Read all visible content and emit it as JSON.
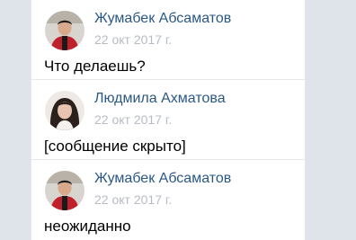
{
  "messages": [
    {
      "author": "Жумабек Абсаматов",
      "date": "22 окт 2017 г.",
      "text": "Что делаешь?",
      "avatar": "male-avatar"
    },
    {
      "author": "Людмила Ахматова",
      "date": "22 окт 2017 г.",
      "text": "[сообщение скрыто]",
      "avatar": "female-avatar"
    },
    {
      "author": "Жумабек Абсаматов",
      "date": "22 окт 2017 г.",
      "text": "неожиданно",
      "avatar": "male-avatar"
    }
  ],
  "colors": {
    "author": "#2a5885",
    "date": "#b7bcc4",
    "background": "#dfe3ea"
  }
}
